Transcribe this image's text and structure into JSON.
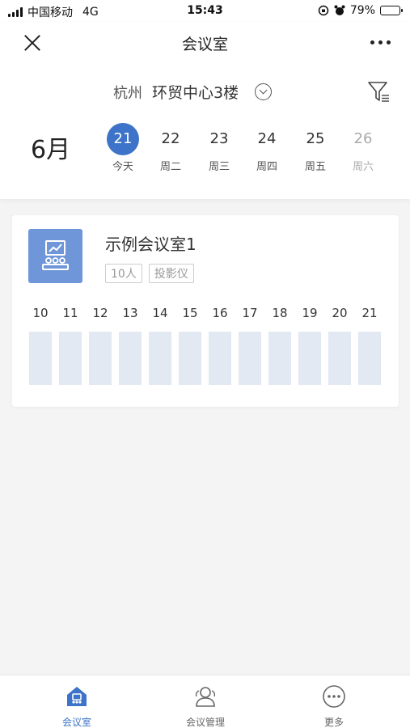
{
  "status_bar": {
    "carrier": "中国移动",
    "network": "4G",
    "time": "15:43",
    "battery": "79%",
    "battery_level": 0.79
  },
  "nav": {
    "title": "会议室"
  },
  "location": {
    "city": "杭州",
    "building": "环贸中心3楼"
  },
  "calendar": {
    "month": "6月",
    "days": [
      {
        "num": "21",
        "label": "今天"
      },
      {
        "num": "22",
        "label": "周二"
      },
      {
        "num": "23",
        "label": "周三"
      },
      {
        "num": "24",
        "label": "周四"
      },
      {
        "num": "25",
        "label": "周五"
      },
      {
        "num": "26",
        "label": "周六"
      }
    ]
  },
  "room": {
    "name": "示例会议室1",
    "tags": [
      "10人",
      "投影仪"
    ],
    "hours": [
      "10",
      "11",
      "12",
      "13",
      "14",
      "15",
      "16",
      "17",
      "18",
      "19",
      "20",
      "21"
    ]
  },
  "tabs": [
    {
      "label": "会议室",
      "icon": "meeting-room-icon"
    },
    {
      "label": "会议管理",
      "icon": "people-icon"
    },
    {
      "label": "更多",
      "icon": "more-icon"
    }
  ],
  "colors": {
    "accent": "#3d73c8",
    "room_icon_bg": "#6f96d8",
    "slot": "#e2e9f2"
  }
}
